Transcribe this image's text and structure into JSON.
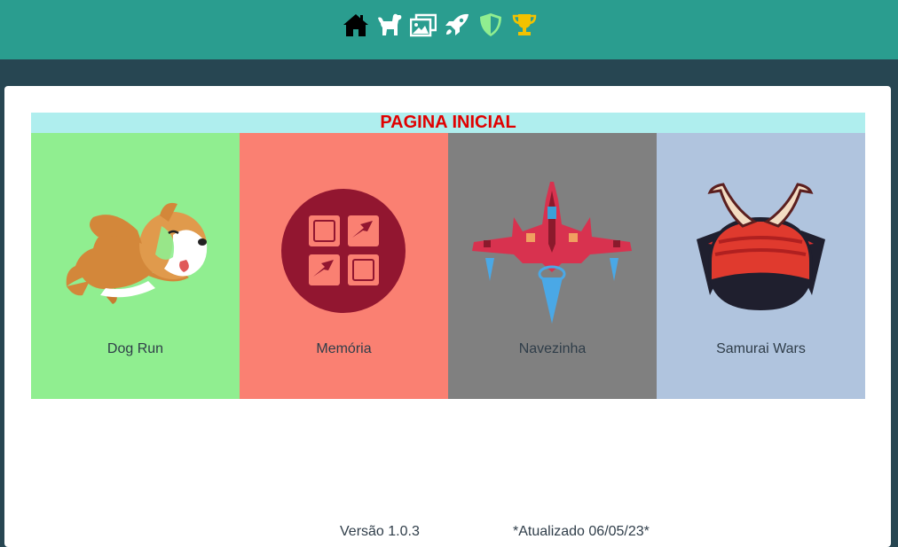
{
  "nav": {
    "items": [
      {
        "icon": "home-icon",
        "color": "#000000"
      },
      {
        "icon": "dog-icon",
        "color": "#ffffff"
      },
      {
        "icon": "images-icon",
        "color": "#ffffff"
      },
      {
        "icon": "rocket-icon",
        "color": "#ffffff"
      },
      {
        "icon": "shield-icon",
        "color": "#90ee90"
      },
      {
        "icon": "trophy-icon",
        "color": "#f2c200"
      }
    ]
  },
  "page": {
    "title": "PAGINA INICIAL",
    "title_color": "#e00000",
    "header_bg": "#afeeee"
  },
  "games": [
    {
      "label": "Dog Run",
      "bg": "#90ee90"
    },
    {
      "label": "Memória",
      "bg": "#fa8072"
    },
    {
      "label": "Navezinha",
      "bg": "#808080"
    },
    {
      "label": "Samurai Wars",
      "bg": "#b0c4de"
    }
  ],
  "footer": {
    "version": "Versão 1.0.3",
    "updated": "*Atualizado 06/05/23*"
  }
}
